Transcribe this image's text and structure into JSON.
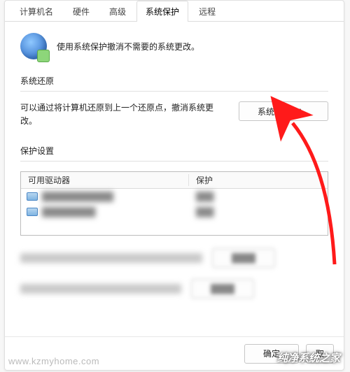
{
  "tabs": {
    "t0": "计算机名",
    "t1": "硬件",
    "t2": "高级",
    "t3": "系统保护",
    "t4": "远程"
  },
  "intro": {
    "text": "使用系统保护撤消不需要的系统更改。"
  },
  "restore": {
    "group": "系统还原",
    "desc": "可以通过将计算机还原到上一个还原点，撤消系统更改。",
    "button": "系统还原(S)..."
  },
  "protection": {
    "group": "保护设置",
    "col_drives": "可用驱动器",
    "col_status": "保护"
  },
  "footer": {
    "ok": "确定",
    "cancel": "取"
  },
  "watermarks": {
    "left": "www.kzmyhome.com",
    "right": "纯净系统之家"
  }
}
